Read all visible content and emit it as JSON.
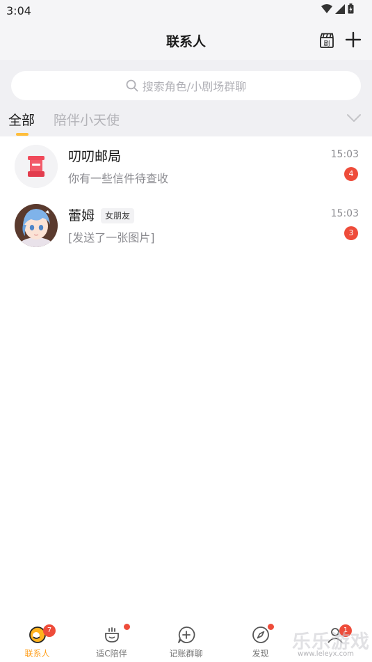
{
  "status_bar": {
    "time": "3:04"
  },
  "header": {
    "title": "联系人"
  },
  "search": {
    "placeholder": "搜索角色/小剧场群聊"
  },
  "tabs": [
    {
      "label": "全部",
      "active": true
    },
    {
      "label": "陪伴小天使",
      "active": false
    }
  ],
  "contacts": [
    {
      "name": "叨叨邮局",
      "tag": "",
      "preview": "你有一些信件待查收",
      "time": "15:03",
      "unread": "4",
      "avatar_icon": "mailbox-icon"
    },
    {
      "name": "蕾姆",
      "tag": "女朋友",
      "preview": "[发送了一张图片]",
      "time": "15:03",
      "unread": "3",
      "avatar_icon": "character-avatar"
    }
  ],
  "bottom_nav": [
    {
      "label": "联系人",
      "active": true,
      "badge": "7",
      "icon": "contacts-icon"
    },
    {
      "label": "适C陪伴",
      "active": false,
      "dot": true,
      "icon": "companion-icon"
    },
    {
      "label": "记账群聊",
      "active": false,
      "icon": "chat-plus-icon"
    },
    {
      "label": "发现",
      "active": false,
      "dot": true,
      "icon": "compass-icon"
    },
    {
      "label": "",
      "active": false,
      "badge": "1",
      "icon": "profile-icon"
    }
  ],
  "watermark": {
    "text": "乐乐游戏",
    "url": "www.leleyx.com"
  },
  "colors": {
    "accent": "#ffbe3b",
    "badge": "#ee4c3a",
    "active_nav": "#ff9f1c"
  }
}
